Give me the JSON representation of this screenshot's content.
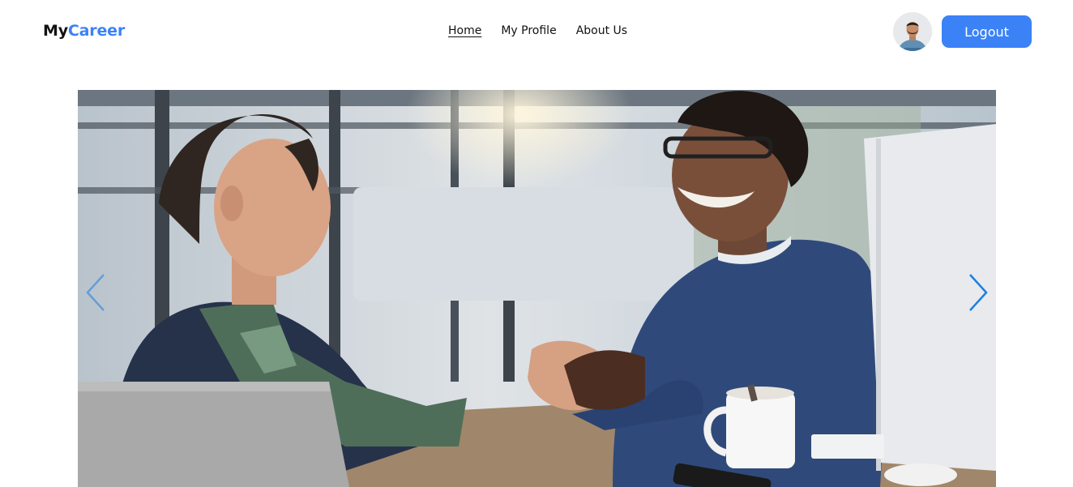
{
  "brand": {
    "part1": "My",
    "part2": "Career"
  },
  "nav": {
    "items": [
      {
        "label": "Home",
        "active": true
      },
      {
        "label": "My Profile",
        "active": false
      },
      {
        "label": "About Us",
        "active": false
      }
    ]
  },
  "header": {
    "logout_label": "Logout"
  },
  "colors": {
    "accent": "#3b82f6",
    "text": "#111111",
    "background": "#ffffff"
  },
  "carousel": {
    "image": "handshake-meeting-photo",
    "prev_icon": "chevron-left-icon",
    "next_icon": "chevron-right-icon"
  }
}
